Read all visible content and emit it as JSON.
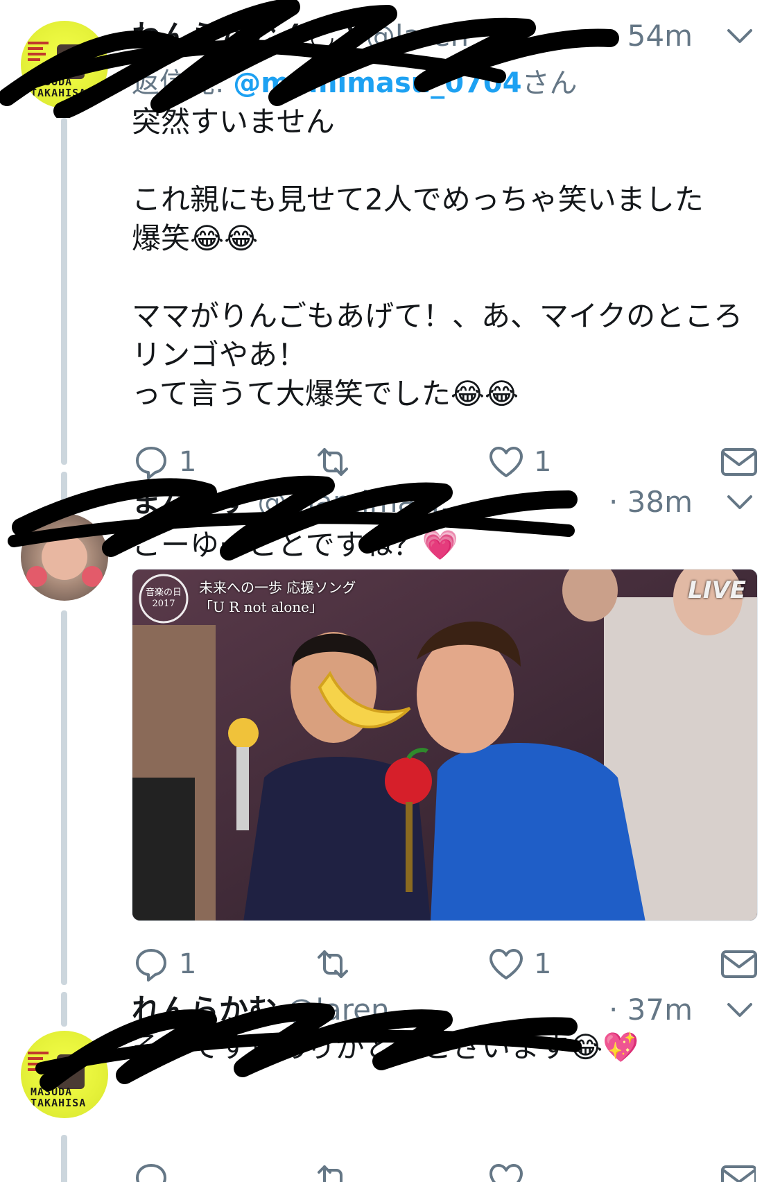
{
  "tweets": [
    {
      "name": "わんらかむ ( ◡̈ )",
      "handle": "@laren",
      "time": "54m",
      "reply_prefix": "返信先: ",
      "reply_handle": "@mamimasu_0704",
      "reply_suffix": "さん",
      "text": "突然すいません\n\nこれ親にも見せて2人でめっちゃ笑いました\n爆笑😂😂\n\nママがりんごもあげて！、あ、マイクのところリンゴやあ！\nって言うて大爆笑でした😂😂",
      "reply_count": "1",
      "like_count": "1",
      "avatar_text": "MASUDA\nTAKAHISA"
    },
    {
      "name": "まなます",
      "handle": "@mamimas...",
      "time": "· 38m",
      "text": "こーゆーことですね？💗",
      "media": {
        "alt": "Music show screenshot with two women singing, banana and apple stickers",
        "overlay_topleft": "音楽の日 2017",
        "overlay_title": "未来への一歩 応援ソング",
        "overlay_sub": "「U R not alone」",
        "overlay_live": "LIVE"
      },
      "reply_count": "1",
      "like_count": "1"
    },
    {
      "name": "れんらかむ",
      "handle": "@laren...",
      "time": "· 37m",
      "text": "そうです！ありがとうございます😂💖",
      "avatar_text": "MASUDA\nTAKAHISA"
    }
  ],
  "colors": {
    "accent": "#1da1f2",
    "muted": "#657786",
    "thread_line": "#ccd6dd"
  },
  "icons": [
    "reply-icon",
    "retweet-icon",
    "like-icon",
    "dm-icon",
    "chevron-down-icon"
  ]
}
